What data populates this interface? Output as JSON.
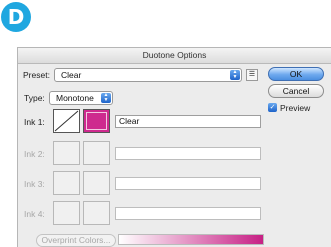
{
  "step_badge": "D",
  "dialog": {
    "title": "Duotone Options",
    "preset_label": "Preset:",
    "preset_value": "Clear",
    "type_label": "Type:",
    "type_value": "Monotone",
    "buttons": {
      "ok": "OK",
      "cancel": "Cancel"
    },
    "preview_label": "Preview",
    "preview_checked": true,
    "inks": [
      {
        "label": "Ink 1:",
        "name": "Clear",
        "color": "#ce2a8e",
        "enabled": true
      },
      {
        "label": "Ink 2:",
        "name": "",
        "enabled": false
      },
      {
        "label": "Ink 3:",
        "name": "",
        "enabled": false
      },
      {
        "label": "Ink 4:",
        "name": "",
        "enabled": false
      }
    ],
    "overprint_label": "Overprint Colors...",
    "accent_color": "#1fa7e0"
  }
}
